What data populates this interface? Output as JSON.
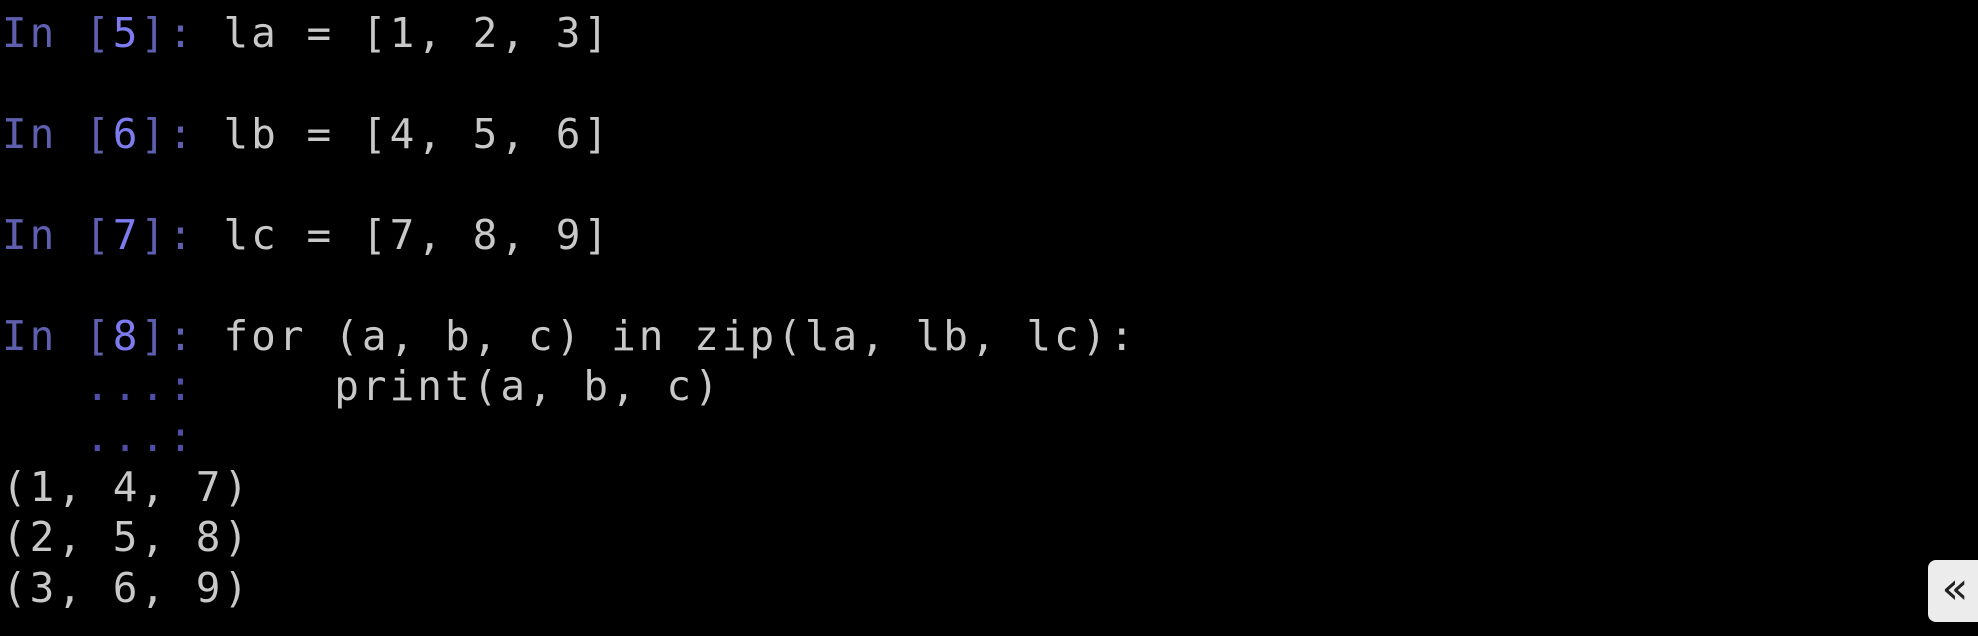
{
  "colors": {
    "background": "#000000",
    "text": "#c8c8c8",
    "prompt": "#5f5fb0",
    "prompt_number": "#7c7cf0"
  },
  "cells": [
    {
      "prompt_in": "In [",
      "number": "5",
      "prompt_close": "]:",
      "code": "la = [1, 2, 3]"
    },
    {
      "prompt_in": "In [",
      "number": "6",
      "prompt_close": "]:",
      "code": "lb = [4, 5, 6]"
    },
    {
      "prompt_in": "In [",
      "number": "7",
      "prompt_close": "]:",
      "code": "lc = [7, 8, 9]"
    },
    {
      "prompt_in": "In [",
      "number": "8",
      "prompt_close": "]:",
      "code": "for (a, b, c) in zip(la, lb, lc):"
    }
  ],
  "continuation": [
    {
      "prompt": "   ...:",
      "code": "    print(a, b, c)"
    },
    {
      "prompt": "   ...:",
      "code": ""
    }
  ],
  "output": [
    "(1, 4, 7)",
    "(2, 5, 8)",
    "(3, 6, 9)"
  ],
  "collapse_button": {
    "icon": "double-chevron-left-icon",
    "glyph": "«"
  }
}
